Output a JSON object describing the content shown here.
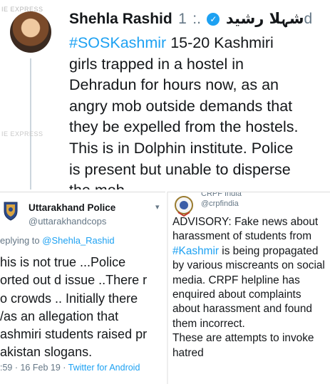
{
  "top_tweet": {
    "watermark": "IE EXPRESS",
    "author_name": "Shehla Rashid",
    "author_name_urdu": "شہلا رشید",
    "dots": ".:",
    "time": "1d",
    "hashtag": "#SOSKashmir",
    "body_lines": [
      " 15-20 Kashmiri",
      "girls trapped in a hostel in",
      "Dehradun for hours now, as an",
      "angry mob outside demands that",
      "they be expelled from the hostels.",
      "This is in Dolphin institute. Police",
      "is present but unable to disperse",
      "the mob."
    ]
  },
  "left_tweet": {
    "author_name": "Uttarakhand Police",
    "handle": "@uttarakhandcops",
    "reply_prefix": "eplying to ",
    "reply_mention": "@Shehla_Rashid",
    "body_lines": [
      "his is not true ...Police",
      "orted out d issue ..There r",
      "o crowds .. Initially there",
      "/as an allegation that",
      "ashmiri students raised pr",
      "akistan slogans."
    ],
    "meta_time": ":59 · 16 Feb 19 · ",
    "meta_source": "Twitter for Android"
  },
  "right_tweet": {
    "top_name_fragment": "CRPF India",
    "handle": "@crpfindia",
    "body_part1": "ADVISORY: Fake news about harassment of students from ",
    "hashtag": "#Kashmir",
    "body_part2": " is being propagated by various miscreants on social media. CRPF helpline has  enquired about complaints about harassment and found them incorrect.",
    "body_part3": "These are attempts to invoke hatred"
  },
  "colors": {
    "link": "#1da1f2",
    "text": "#14171a",
    "muted": "#657786"
  }
}
